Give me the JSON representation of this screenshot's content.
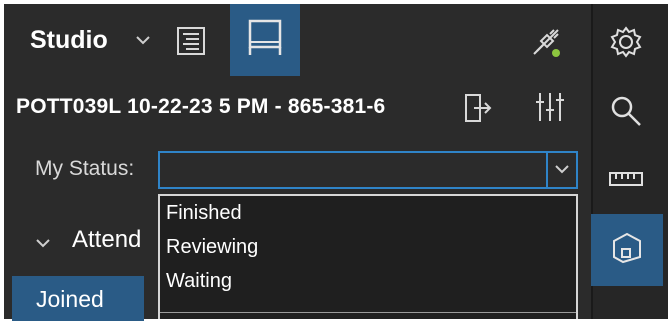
{
  "header": {
    "title": "Studio",
    "title_dropdown_icon": "chevron-down-icon",
    "tool_document_icon": "document-lines-icon",
    "tool_active_icon": "panel-icon",
    "connection_icon": "plug-disconnected-icon"
  },
  "file": {
    "name": "POTT039L 10-22-23 5 PM - 865-381-6",
    "export_icon": "export-icon",
    "settings_sliders_icon": "sliders-icon"
  },
  "status": {
    "label": "My Status:",
    "value": "",
    "options": [
      "Finished",
      "Reviewing",
      "Waiting"
    ]
  },
  "attendees": {
    "label": "Attend",
    "expand_icon": "chevron-down-icon"
  },
  "tabs": {
    "joined": "Joined"
  },
  "rail": {
    "icons": [
      "gear-icon",
      "search-icon",
      "ruler-icon",
      "shape-icon"
    ]
  },
  "colors": {
    "panel_bg": "#2b2b2b",
    "accent": "#2a5b86",
    "focus_border": "#2f84c8",
    "plug_indicator": "#8dc63f"
  }
}
